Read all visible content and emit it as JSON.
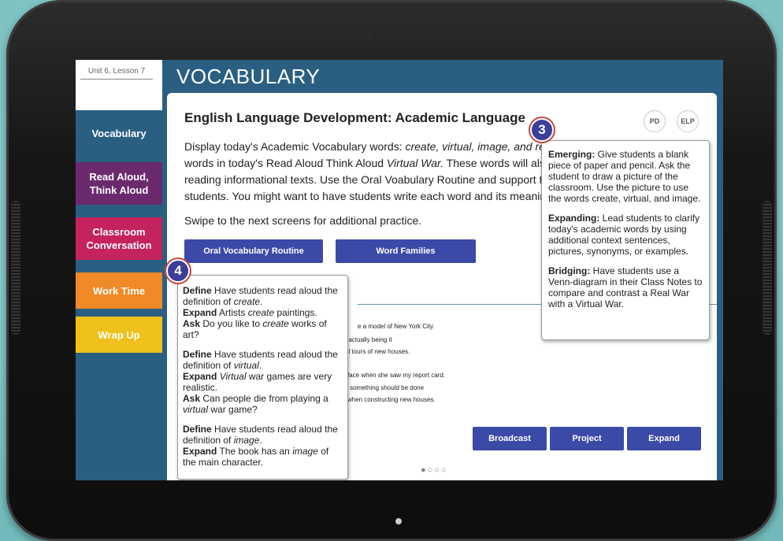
{
  "lesson": "Unit 6, Lesson 7",
  "header": {
    "title": "VOCABULARY"
  },
  "sidebar": {
    "items": [
      {
        "label": "Vocabulary",
        "color": "#2b5f82"
      },
      {
        "label": "Read Aloud, Think Aloud",
        "color": "#6b2a6e"
      },
      {
        "label": "Classroom Conversation",
        "color": "#c4235e"
      },
      {
        "label": "Work Time",
        "color": "#f08a26"
      },
      {
        "label": "Wrap Up",
        "color": "#efc11a"
      }
    ]
  },
  "content": {
    "title": "English Language Development: Academic Language",
    "body_parts": [
      "Display today's Academic Vocabulary words: ",
      "create, virtual, image, and re",
      "words in today's Read Aloud Think Aloud ",
      "Virtual War.",
      " These words will als",
      "reading informational texts. Use the Oral Voabulary Routine and support to",
      "students. You might want to have students write each word and its meaning"
    ],
    "swipe_text": "Swipe to the next screens for additional practice.",
    "pd_label": "PD",
    "elp_label": "ELP",
    "btn_oral": "Oral Vocabulary Routine",
    "btn_families": "Word Families",
    "examples": [
      "e a model of New York City.",
      "t actually being it",
      "al tours of new houses.",
      "face when she saw my report card.",
      "v something should be done",
      "when constructing new houses."
    ],
    "btn_broadcast": "Broadcast",
    "btn_project": "Project",
    "btn_expand": "Expand",
    "pager": "●○○○"
  },
  "elp_popup": {
    "badge": "3",
    "emerging_label": "Emerging:",
    "emerging_text": " Give students a blank piece of paper and pencil. Ask the student to draw a picture of the classroom. Use the picture to use the words create, virtual, and image.",
    "expanding_label": "Expanding:",
    "expanding_text": " Lead students to clarify today's academic words by using additional context sentences, pictures, synonyms, or examples.",
    "bridging_label": "Bridging:",
    "bridging_text": " Have students use a Venn-diagram in their Class Notes to compare and contrast a Real War with a Virtual War."
  },
  "routine_popup": {
    "badge": "4",
    "define": "Define",
    "expand": "Expand",
    "ask": "Ask",
    "b1_define": " Have students read aloud the definition of ",
    "b1_word": "create",
    "b1_expand": " Artists ",
    "b1_expand_word": "create",
    "b1_expand_tail": " paintings.",
    "b1_ask": " Do you like to ",
    "b1_ask_word": "create",
    "b1_ask_tail": " works of art?",
    "b2_define": " Have students read aloud the definition of ",
    "b2_word": "virtual",
    "b2_expand_word": "Virtual",
    "b2_expand_tail": " war games are very realistic.",
    "b2_ask": " Can people die from playing a ",
    "b2_ask_word": "virtual",
    "b2_ask_tail": " war game?",
    "b3_define": " Have students read aloud the definition of ",
    "b3_word": "image",
    "b3_expand": " The book has an ",
    "b3_expand_word": "image",
    "b3_expand_tail": " of the main character."
  }
}
